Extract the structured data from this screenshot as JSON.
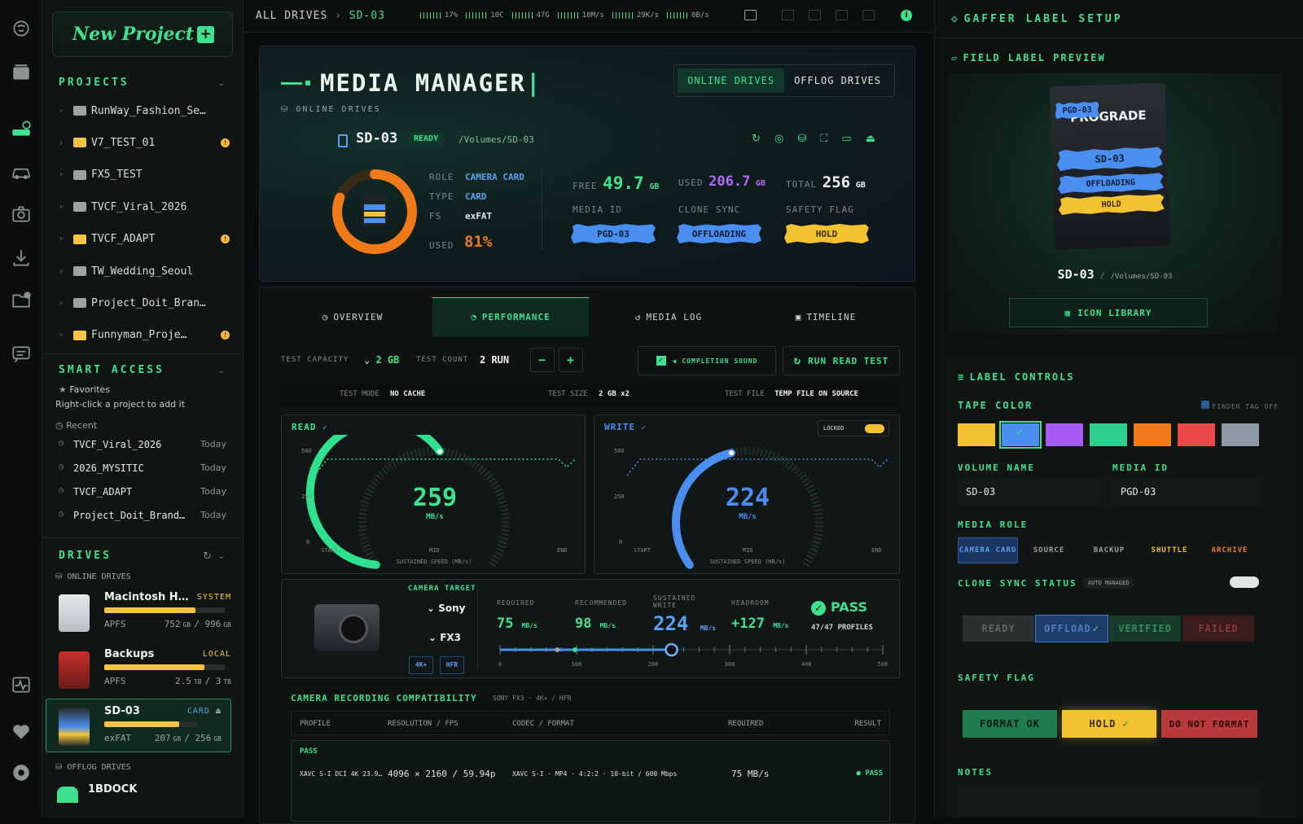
{
  "topbar": {
    "breadcrumb_root": "ALL DRIVES",
    "breadcrumb_sep": "›",
    "breadcrumb_current": "SD-03",
    "stats": [
      "17%",
      "10C",
      "47G",
      "10M/s",
      "29K/s",
      "0B/s"
    ]
  },
  "sidebar": {
    "new_project_label": "New Project",
    "new_project_plus": "+",
    "projects_heading": "PROJECTS",
    "projects": [
      {
        "name": "RunWay_Fashion_Se…",
        "folder": "gray",
        "alert": false
      },
      {
        "name": "V7_TEST_01",
        "folder": "yellow",
        "alert": true
      },
      {
        "name": "FX5_TEST",
        "folder": "gray",
        "alert": false
      },
      {
        "name": "TVCF_Viral_2026",
        "folder": "gray",
        "alert": false
      },
      {
        "name": "TVCF_ADAPT",
        "folder": "yellow",
        "alert": true
      },
      {
        "name": "TW_Wedding_Seoul",
        "folder": "gray",
        "alert": false
      },
      {
        "name": "Project_Doit_Bran…",
        "folder": "gray",
        "alert": false
      },
      {
        "name": "Funnyman_Proje…",
        "folder": "yellow",
        "alert": true
      }
    ],
    "smart_access_heading": "SMART ACCESS",
    "favorites_label": "Favorites",
    "favorites_hint": "Right-click a project to add it",
    "recent_label": "Recent",
    "recent": [
      {
        "name": "TVCF_Viral_2026",
        "date": "Today"
      },
      {
        "name": "2026_MYSITIC",
        "date": "Today"
      },
      {
        "name": "TVCF_ADAPT",
        "date": "Today"
      },
      {
        "name": "Project_Doit_Brand…",
        "date": "Today"
      }
    ],
    "drives_heading": "DRIVES",
    "online_drives_label": "ONLINE DRIVES",
    "drives": [
      {
        "name": "Macintosh H…",
        "tag": "SYSTEM",
        "fs": "APFS",
        "used": "752",
        "used_unit": "GB",
        "total": "996",
        "total_unit": "GB",
        "fill": 0.76
      },
      {
        "name": "Backups",
        "tag": "LOCAL",
        "fs": "APFS",
        "used": "2.5",
        "used_unit": "TB",
        "total": "3",
        "total_unit": "TB",
        "fill": 0.83
      },
      {
        "name": "SD-03",
        "tag": "CARD",
        "fs": "exFAT",
        "used": "207",
        "used_unit": "GB",
        "total": "256",
        "total_unit": "GB",
        "fill": 0.81
      }
    ],
    "offlog_drives_label": "OFFLOG DRIVES",
    "offlog_drive": "1BDOCK"
  },
  "hero": {
    "title": "MEDIA MANAGER",
    "subtitle": "ONLINE DRIVES",
    "toggle_online": "ONLINE DRIVES",
    "toggle_offlog": "OFFLOG DRIVES",
    "drive_name": "SD-03",
    "status": "READY",
    "path": "/Volumes/SD-03",
    "role_key": "ROLE",
    "role_val": "CAMERA CARD",
    "type_key": "TYPE",
    "type_val": "CARD",
    "fs_key": "FS",
    "fs_val": "exFAT",
    "used_key": "USED",
    "used_pct": "81%",
    "used_fraction": 0.81,
    "free_label": "FREE",
    "free_val": "49.7",
    "free_unit": "GB",
    "used_label": "USED",
    "used_val": "206.7",
    "used_unit": "GB",
    "total_label": "TOTAL",
    "total_val": "256",
    "total_unit": "GB",
    "media_id_label": "MEDIA ID",
    "media_id": "PGD-03",
    "clone_sync_label": "CLONE SYNC",
    "clone_sync": "OFFLOADING",
    "safety_flag_label": "SAFETY FLAG",
    "safety_flag": "HOLD"
  },
  "tabs": [
    "OVERVIEW",
    "PERFORMANCE",
    "MEDIA LOG",
    "TIMELINE"
  ],
  "perf": {
    "capacity_label": "TEST CAPACITY",
    "capacity_val": "2 GB",
    "count_label": "TEST COUNT",
    "count_val": "2 RUN",
    "minus": "−",
    "plus": "+",
    "completion_sound": "COMPLETION SOUND",
    "run_test": "RUN READ TEST",
    "mode_label": "TEST MODE",
    "mode_val": "NO CACHE",
    "size_label": "TEST SIZE",
    "size_val": "2 GB x2",
    "file_label": "TEST FILE",
    "file_val": "TEMP FILE ON SOURCE",
    "read_title": "READ",
    "read_speed": "259",
    "read_fraction": 0.518,
    "write_title": "WRITE",
    "write_speed": "224",
    "write_fraction": 0.448,
    "speed_unit": "MB/s",
    "gauge_caption": "SUSTAINED SPEED (MB/s)",
    "locked": "LOCKED",
    "axis_top": "500",
    "axis_mid": "250",
    "axis_zero": "0",
    "start": "START",
    "mid": "MID",
    "end": "END"
  },
  "camera": {
    "target_label": "CAMERA TARGET",
    "brand": "Sony",
    "model": "FX3",
    "badges": [
      "4K+",
      "HFR"
    ],
    "required_label": "REQUIRED",
    "required": "75",
    "recommended_label": "RECOMMENDED",
    "recommended": "98",
    "sustained_label": "SUSTAINED WRITE",
    "sustained": "224",
    "headroom_label": "HEADROOM",
    "headroom": "+127",
    "unit": "MB/s",
    "pass": "PASS",
    "profiles": "47/47 PROFILES",
    "scale": [
      "0",
      "100",
      "200",
      "300",
      "400",
      "500"
    ]
  },
  "compat": {
    "title": "CAMERA RECORDING COMPATIBILITY",
    "subtitle": "SONY FX3 · 4K+ / HFR",
    "headers": [
      "PROFILE",
      "RESOLUTION / FPS",
      "CODEC / FORMAT",
      "REQUIRED",
      "RESULT"
    ],
    "group": "PASS",
    "rows": [
      {
        "profile": "XAVC S-I DCI 4K 23.9…",
        "res": "4096 × 2160 / 59.94p",
        "codec": "XAVC S-I · MP4 · 4:2:2 · 10-bit / 600 Mbps",
        "req": "75 MB/s",
        "result": "PASS"
      }
    ]
  },
  "gaffer": {
    "title": "GAFFER LABEL SETUP",
    "preview_label": "FIELD LABEL PREVIEW",
    "card_brand": "PROGRADE",
    "tape_media_id": "PGD-03",
    "tape_name": "SD-03",
    "tape_sync": "OFFLOADING",
    "tape_flag": "HOLD",
    "card_caption": "SD-03",
    "card_path": "/Volumes/SD-03",
    "icon_library": "ICON LIBRARY",
    "controls_label": "LABEL CONTROLS",
    "tape_color_label": "TAPE COLOR",
    "finder_tag": "FINDER TAG OFF",
    "tape_colors": [
      "#f2c230",
      "#4a8ef0",
      "#a45cf0",
      "#2fd08e",
      "#f07a1a",
      "#e84848",
      "#8f9aa6"
    ],
    "volume_name_label": "VOLUME NAME",
    "volume_name": "SD-03",
    "media_id_label": "MEDIA ID",
    "media_id": "PGD-03",
    "media_role_label": "MEDIA ROLE",
    "roles": [
      "CAMERA CARD",
      "SOURCE",
      "BACKUP",
      "SHUTTLE",
      "ARCHIVE"
    ],
    "clone_status_label": "CLONE SYNC STATUS",
    "auto_managed": "AUTO MANAGED",
    "statuses": [
      "READY",
      "OFFLOAD",
      "VERIFIED",
      "FAILED"
    ],
    "safety_label": "SAFETY FLAG",
    "flags": [
      "FORMAT OK",
      "HOLD",
      "DO NOT FORMAT"
    ],
    "notes_label": "NOTES"
  }
}
